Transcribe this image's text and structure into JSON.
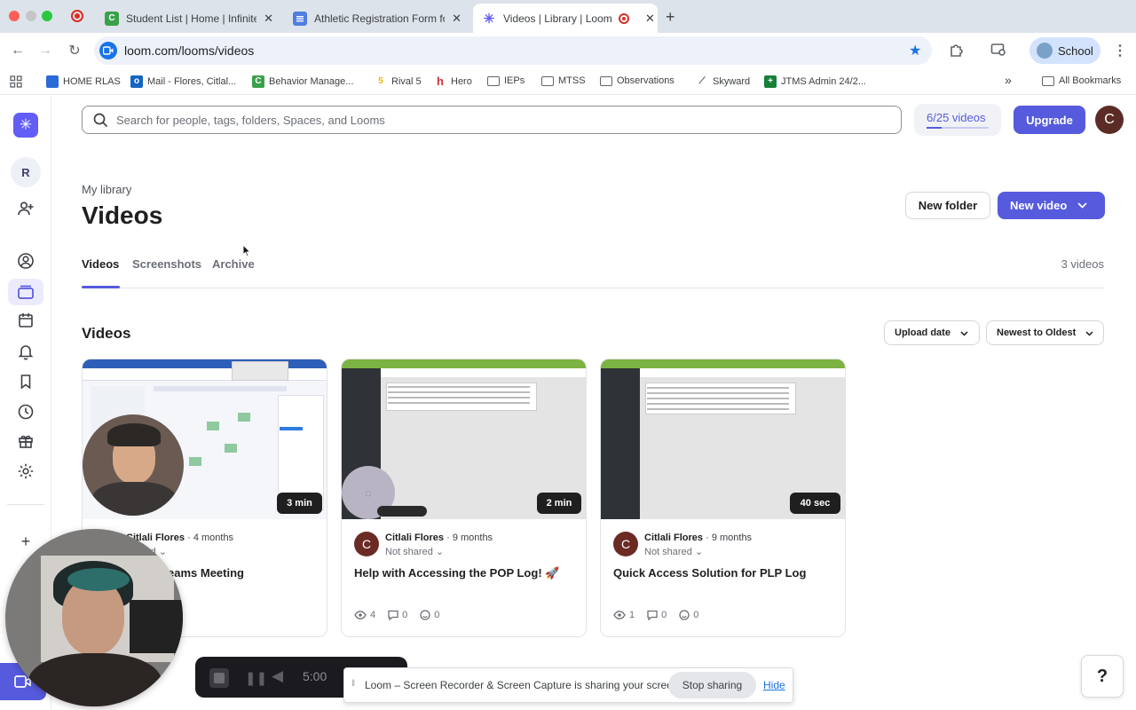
{
  "browser": {
    "tabs": [
      {
        "title": "Student List | Home | Infinite C",
        "favicon_color": "#3aa14a",
        "favicon_letter": "C"
      },
      {
        "title": "Athletic Registration Form for",
        "favicon_color": "#4f7de0",
        "favicon_letter": ""
      },
      {
        "title": "Videos | Library | Loom",
        "favicon_color": "#625df5",
        "favicon_letter": "✳"
      }
    ],
    "new_tab": "+",
    "url": "loom.com/looms/videos",
    "profile_label": "School",
    "bookmarks": [
      {
        "label": "HOME RLAS",
        "icon_color": "#2c6ad8",
        "icon": "folder"
      },
      {
        "label": "Mail - Flores, Citlal...",
        "icon_color": "#1565c0",
        "icon": "mail"
      },
      {
        "label": "Behavior Manage...",
        "icon_color": "#3aa14a",
        "icon": "C"
      },
      {
        "label": "Rival 5",
        "icon_color": "#f0b400",
        "icon": "5"
      },
      {
        "label": "Hero",
        "icon_color": "#d32f2f",
        "icon": "h"
      },
      {
        "label": "IEPs",
        "icon_color": "#5f6368",
        "icon": "folder"
      },
      {
        "label": "MTSS",
        "icon_color": "#5f6368",
        "icon": "folder"
      },
      {
        "label": "Observations",
        "icon_color": "#5f6368",
        "icon": "folder"
      },
      {
        "label": "Skyward",
        "icon_color": "#555",
        "icon": "sky"
      },
      {
        "label": "JTMS Admin 24/2...",
        "icon_color": "#188038",
        "icon": "sheet"
      }
    ],
    "bookmarks_overflow": "»",
    "all_bookmarks": "All Bookmarks"
  },
  "sidebar": {
    "workspace_initial": "R"
  },
  "topbar": {
    "search_placeholder": "Search for people, tags, folders, Spaces, and Looms",
    "quota_label": "6/25 videos",
    "quota_fraction": 0.24,
    "upgrade_label": "Upgrade",
    "avatar_initial": "C"
  },
  "page": {
    "breadcrumb": "My library",
    "title": "Videos",
    "new_folder_label": "New folder",
    "new_video_label": "New video",
    "tabs": [
      "Videos",
      "Screenshots",
      "Archive"
    ],
    "active_tab": "Videos",
    "count_label": "3 videos",
    "section_title": "Videos",
    "sort_field": "Upload date",
    "sort_order": "Newest to Oldest"
  },
  "videos": [
    {
      "author": "Citlali Flores",
      "age": "· 4 months",
      "sharing": "shared",
      "title": "eams Meeting",
      "duration": "3 min",
      "views": "",
      "comments": "",
      "reactions": "",
      "avatar": "C"
    },
    {
      "author": "Citlali Flores",
      "age": "· 9 months",
      "sharing": "Not shared",
      "title": "Help with Accessing the POP Log! 🚀",
      "duration": "2 min",
      "views": "4",
      "comments": "0",
      "reactions": "0",
      "avatar": "C"
    },
    {
      "author": "Citlali Flores",
      "age": "· 9 months",
      "sharing": "Not shared",
      "title": "Quick Access Solution for PLP Log",
      "duration": "40 sec",
      "views": "1",
      "comments": "0",
      "reactions": "0",
      "avatar": "C"
    }
  ],
  "recorder": {
    "timer": "5:00"
  },
  "share_notice": {
    "message": "Loom – Screen Recorder & Screen Capture is sharing your screen.",
    "stop_label": "Stop sharing",
    "hide_label": "Hide"
  },
  "help_label": "?",
  "colors": {
    "accent": "#565add",
    "loom_purple": "#625df5",
    "avatar_brown": "#5b2c25"
  }
}
